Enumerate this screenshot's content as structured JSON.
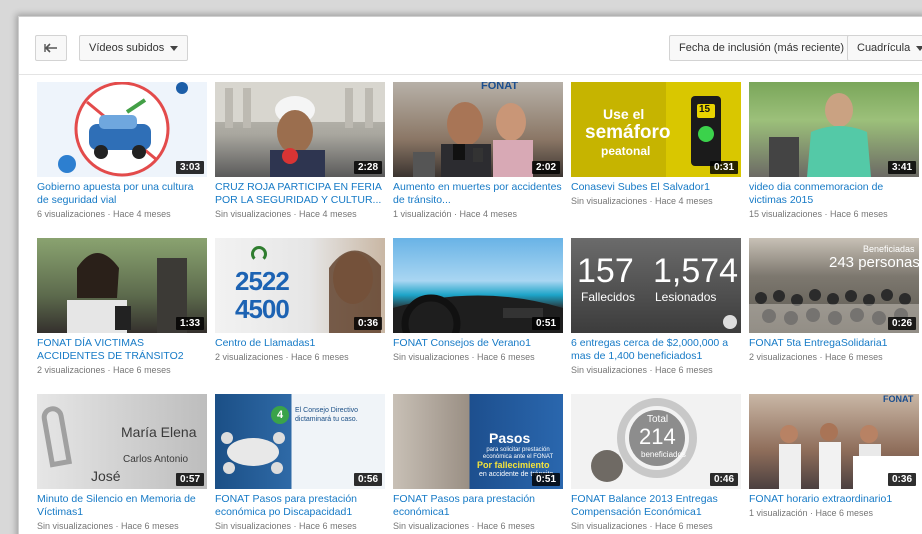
{
  "toolbar": {
    "videos_label": "Vídeos subidos",
    "sort_label": "Fecha de inclusión (más reciente)",
    "view_label": "Cuadrícula"
  },
  "videos": [
    {
      "title": "Gobierno apuesta por una cultura de seguridad vial",
      "views": "6 visualizaciones",
      "age": "Hace 4 meses",
      "duration": "3:03"
    },
    {
      "title": "CRUZ ROJA PARTICIPA EN FERIA POR LA SEGURIDAD Y CULTUR...",
      "views": "Sin visualizaciones",
      "age": "Hace 4 meses",
      "duration": "2:28"
    },
    {
      "title": "Aumento en muertes por accidentes de tránsito...",
      "views": "1 visualización",
      "age": "Hace 4 meses",
      "duration": "2:02"
    },
    {
      "title": "Conasevi Subes El Salvador1",
      "views": "Sin visualizaciones",
      "age": "Hace 4 meses",
      "duration": "0:31"
    },
    {
      "title": "video dia conmemoracion de victimas 2015",
      "views": "15 visualizaciones",
      "age": "Hace 6 meses",
      "duration": "3:41"
    },
    {
      "title": "FONAT DÍA VICTIMAS ACCIDENTES DE TRÁNSITO2",
      "views": "2 visualizaciones",
      "age": "Hace 6 meses",
      "duration": "1:33"
    },
    {
      "title": "Centro de Llamadas1",
      "views": "2 visualizaciones",
      "age": "Hace 6 meses",
      "duration": "0:36"
    },
    {
      "title": "FONAT Consejos de Verano1",
      "views": "Sin visualizaciones",
      "age": "Hace 6 meses",
      "duration": "0:51"
    },
    {
      "title": "6 entregas cerca de $2,000,000 a mas de 1,400 beneficiados1",
      "views": "Sin visualizaciones",
      "age": "Hace 6 meses",
      "duration": ""
    },
    {
      "title": "FONAT 5ta EntregaSolidaria1",
      "views": "2 visualizaciones",
      "age": "Hace 6 meses",
      "duration": "0:26"
    },
    {
      "title": "Minuto de Silencio en Memoria de Víctimas1",
      "views": "Sin visualizaciones",
      "age": "Hace 6 meses",
      "duration": "0:57"
    },
    {
      "title": "FONAT Pasos para prestación económica po Discapacidad1",
      "views": "Sin visualizaciones",
      "age": "Hace 6 meses",
      "duration": "0:56"
    },
    {
      "title": "FONAT Pasos para prestación económica1",
      "views": "Sin visualizaciones",
      "age": "Hace 6 meses",
      "duration": "0:51"
    },
    {
      "title": "FONAT Balance 2013 Entregas Compensación Económica1",
      "views": "Sin visualizaciones",
      "age": "Hace 6 meses",
      "duration": "0:46"
    },
    {
      "title": "FONAT horario extraordinario1",
      "views": "1 visualización",
      "age": "Hace 6 meses",
      "duration": "0:36"
    }
  ],
  "thumb_text": {
    "t3_brand": "FONAT",
    "t4_l1": "Use el",
    "t4_l2": "semáforo",
    "t4_l3": "peatonal",
    "t4_num": "15",
    "t7_l1": "2522",
    "t7_l2": "4500",
    "t9_n1": "157",
    "t9_n2": "1,574",
    "t9_l1": "Fallecidos",
    "t9_l2": "Lesionados",
    "t10_l1": "Beneficiadas",
    "t10_l2": "243 personas",
    "t11_n1": "María Elena",
    "t11_n2": "Carlos Antonio",
    "t11_n3": "José",
    "t12_badge": "4",
    "t12_text": "El Consejo Directivo dictaminará tu caso.",
    "t13_l1": "Pasos",
    "t13_l2": "para solicitar prestación económica ante el FONAT",
    "t13_l3": "Por fallecimiento",
    "t13_l4": "en accidente de tránsito",
    "t14_l1": "Total",
    "t14_l2": "214",
    "t14_l3": "beneficiados",
    "t15_brand": "FONAT"
  },
  "colors": {
    "link": "#167ac6",
    "meta": "#767676",
    "accent_yellow": "#e8d400"
  }
}
